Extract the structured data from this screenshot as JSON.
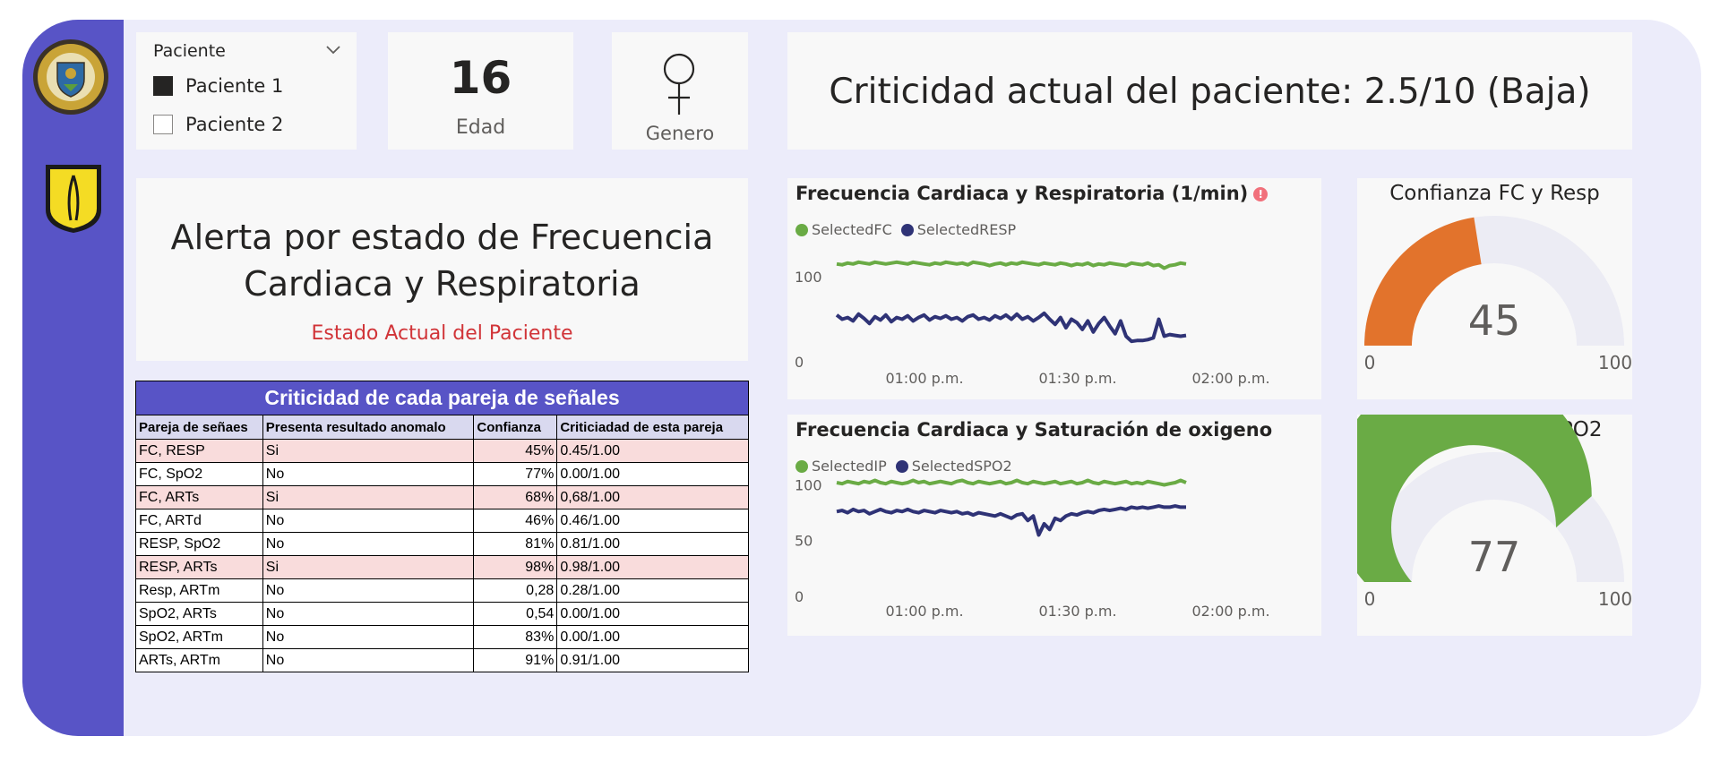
{
  "slicer": {
    "title": "Paciente",
    "options": [
      {
        "label": "Paciente 1",
        "checked": true
      },
      {
        "label": "Paciente 2",
        "checked": false
      }
    ]
  },
  "age": {
    "value": "16",
    "label": "Edad"
  },
  "gender": {
    "label": "Genero",
    "icon": "female-icon"
  },
  "criticality": {
    "text": "Criticidad actual del paciente: 2.5/10 (Baja)"
  },
  "alert": {
    "title": "Alerta por estado de Frecuencia Cardiaca y Respiratoria",
    "subtitle": "Estado Actual del Paciente"
  },
  "table": {
    "title": "Criticidad de cada pareja de señales",
    "columns": [
      "Pareja de señaes",
      "Presenta resultado anomalo",
      "Confianza",
      "Criticiadad de esta pareja"
    ],
    "rows": [
      [
        "FC, RESP",
        "Si",
        "45%",
        "0.45/1.00"
      ],
      [
        "FC, SpO2",
        "No",
        "77%",
        "0.00/1.00"
      ],
      [
        "FC, ARTs",
        "Si",
        "68%",
        "0,68/1.00"
      ],
      [
        "FC, ARTd",
        "No",
        "46%",
        "0.46/1.00"
      ],
      [
        "RESP, SpO2",
        "No",
        "81%",
        "0.81/1.00"
      ],
      [
        "RESP, ARTs",
        "Si",
        "98%",
        "0.98/1.00"
      ],
      [
        "Resp, ARTm",
        "No",
        "0,28",
        "0.28/1.00"
      ],
      [
        "SpO2, ARTs",
        "No",
        "0,54",
        "0.00/1.00"
      ],
      [
        "SpO2, ARTm",
        "No",
        "83%",
        "0.00/1.00"
      ],
      [
        "ARTs, ARTm",
        "No",
        "91%",
        "0.91/1.00"
      ]
    ]
  },
  "colors": {
    "accent": "#5854c6",
    "green": "#6aab45",
    "navy": "#2f3376",
    "orange": "#e2732c",
    "gauge_bg": "#ececf4",
    "alert_red": "#d13438",
    "anomaly_row": "#f9dcdc"
  },
  "chart_data": [
    {
      "type": "line",
      "title": "Frecuencia Cardiaca y Respiratoria (1/min)",
      "alert_icon": "!",
      "x_ticks": [
        "01:00 p.m.",
        "01:30 p.m.",
        "02:00 p.m."
      ],
      "x_range": [
        "12:40 p.m.",
        "02:05 p.m."
      ],
      "ylim": [
        0,
        140
      ],
      "y_ticks": [
        0,
        100
      ],
      "grid": false,
      "legend": "top-left",
      "series": [
        {
          "name": "SelectedFC",
          "color": "#6aab45",
          "values": [
            115,
            114,
            116,
            115,
            117,
            116,
            115,
            117,
            116,
            115,
            116,
            117,
            116,
            115,
            117,
            116,
            115,
            114,
            116,
            115,
            117,
            116,
            115,
            116,
            114,
            117,
            116,
            115,
            113,
            115,
            116,
            114,
            116,
            115,
            117,
            116,
            115,
            114,
            116,
            115,
            114,
            116,
            115,
            113,
            115,
            114,
            116,
            113,
            115,
            114,
            116,
            115,
            114,
            113,
            116,
            115,
            114,
            116,
            113,
            114,
            110,
            113,
            114,
            116,
            115
          ]
        },
        {
          "name": "SelectedRESP",
          "color": "#2f3376",
          "values": [
            55,
            50,
            52,
            48,
            56,
            51,
            45,
            53,
            49,
            55,
            47,
            52,
            50,
            54,
            48,
            52,
            55,
            49,
            53,
            51,
            54,
            50,
            52,
            48,
            53,
            55,
            50,
            52,
            49,
            54,
            51,
            55,
            50,
            56,
            50,
            53,
            48,
            52,
            57,
            50,
            44,
            52,
            40,
            50,
            46,
            38,
            48,
            35,
            45,
            52,
            42,
            33,
            48,
            30,
            24,
            25,
            25,
            26,
            28,
            50,
            30,
            32,
            31,
            30,
            31
          ]
        }
      ]
    },
    {
      "type": "line",
      "title": "Frecuencia Cardiaca y Saturación de oxigeno",
      "x_ticks": [
        "01:00 p.m.",
        "01:30 p.m.",
        "02:00 p.m."
      ],
      "x_range": [
        "12:40 p.m.",
        "02:05 p.m."
      ],
      "ylim": [
        0,
        110
      ],
      "y_ticks": [
        0,
        50,
        100
      ],
      "grid": false,
      "legend": "top-left",
      "series": [
        {
          "name": "SelectedIP",
          "color": "#6aab45",
          "values": [
            102,
            101,
            103,
            102,
            101,
            103,
            102,
            104,
            102,
            101,
            103,
            102,
            101,
            102,
            104,
            102,
            103,
            101,
            102,
            103,
            102,
            101,
            103,
            104,
            102,
            101,
            103,
            102,
            101,
            102,
            103,
            101,
            102,
            104,
            102,
            101,
            103,
            102,
            101,
            102,
            103,
            101,
            102,
            103,
            101,
            102,
            104,
            102,
            101,
            103,
            102,
            101,
            102,
            103,
            101,
            102,
            101,
            103,
            102,
            101,
            100,
            101,
            102,
            104,
            102
          ]
        },
        {
          "name": "SelectedSPO2",
          "color": "#2f3376",
          "values": [
            76,
            77,
            75,
            78,
            76,
            77,
            74,
            76,
            78,
            76,
            75,
            77,
            76,
            78,
            76,
            75,
            77,
            76,
            75,
            77,
            76,
            75,
            76,
            74,
            75,
            73,
            75,
            74,
            73,
            72,
            74,
            72,
            70,
            73,
            74,
            68,
            72,
            55,
            65,
            60,
            70,
            68,
            72,
            74,
            73,
            75,
            76,
            75,
            77,
            78,
            77,
            78,
            79,
            78,
            80,
            79,
            80,
            79,
            80,
            81,
            80,
            80,
            81,
            80,
            80
          ]
        }
      ]
    },
    {
      "type": "gauge",
      "title": "Confianza FC y Resp",
      "value": 45,
      "min_label": "0",
      "max_label": "100",
      "range": [
        0,
        100
      ],
      "color": "#e2732c"
    },
    {
      "type": "gauge",
      "title": "Confianza FC y SPO2",
      "value": 77,
      "min_label": "0",
      "max_label": "100",
      "range": [
        0,
        100
      ],
      "color": "#6aab45"
    }
  ]
}
